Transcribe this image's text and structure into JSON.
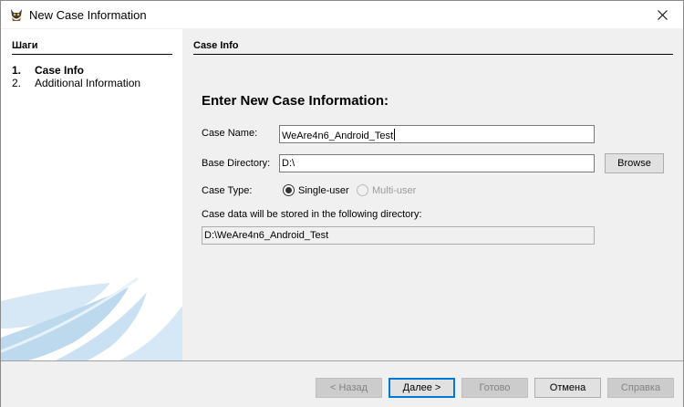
{
  "window": {
    "title": "New Case Information"
  },
  "steps": {
    "header": "Шаги",
    "items": [
      {
        "num": "1.",
        "label": "Case Info",
        "active": true
      },
      {
        "num": "2.",
        "label": "Additional Information",
        "active": false
      }
    ]
  },
  "main": {
    "section_header": "Case Info",
    "form_title": "Enter New Case Information:",
    "case_name_label": "Case Name:",
    "case_name_value": "WeAre4n6_Android_Test",
    "base_dir_label": "Base Directory:",
    "base_dir_value": "D:\\",
    "browse_label": "Browse",
    "case_type_label": "Case Type:",
    "single_user_label": "Single-user",
    "multi_user_label": "Multi-user",
    "storage_label": "Case data will be stored in the following directory:",
    "storage_path": "D:\\WeAre4n6_Android_Test"
  },
  "footer": {
    "back_label": "< Назад",
    "next_label": "Далее >",
    "finish_label": "Готово",
    "cancel_label": "Отмена",
    "help_label": "Справка"
  },
  "colors": {
    "accent": "#0078d7",
    "swoosh": "#bcd9ee"
  }
}
